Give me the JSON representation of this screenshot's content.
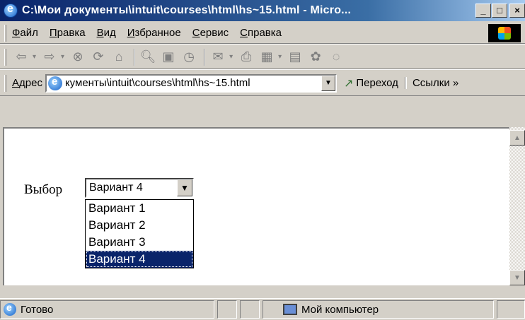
{
  "window": {
    "title": "C:\\Мои документы\\intuit\\courses\\html\\hs~15.html - Micro...",
    "controls": {
      "minimize": "_",
      "maximize": "□",
      "close": "×"
    }
  },
  "menu": {
    "items": [
      "Файл",
      "Правка",
      "Вид",
      "Избранное",
      "Сервис",
      "Справка"
    ]
  },
  "toolbar": {
    "icons": [
      "back-arrow-icon",
      "forward-arrow-icon",
      "stop-icon",
      "refresh-icon",
      "home-icon",
      "search-icon",
      "favorites-icon",
      "history-icon",
      "mail-icon",
      "print-icon",
      "edit-icon",
      "discuss-icon",
      "messenger-icon",
      "chat-icon"
    ]
  },
  "address": {
    "label": "Адрес",
    "value": "кументы\\intuit\\courses\\html\\hs~15.html",
    "go_label": "Переход",
    "links_label": "Ссылки »"
  },
  "content": {
    "select_label": "Выбор",
    "select_value": "Вариант 4",
    "options": [
      "Вариант 1",
      "Вариант 2",
      "Вариант 3",
      "Вариант 4"
    ],
    "selected_index": 3
  },
  "status": {
    "text": "Готово",
    "zone": "Мой компьютер"
  }
}
